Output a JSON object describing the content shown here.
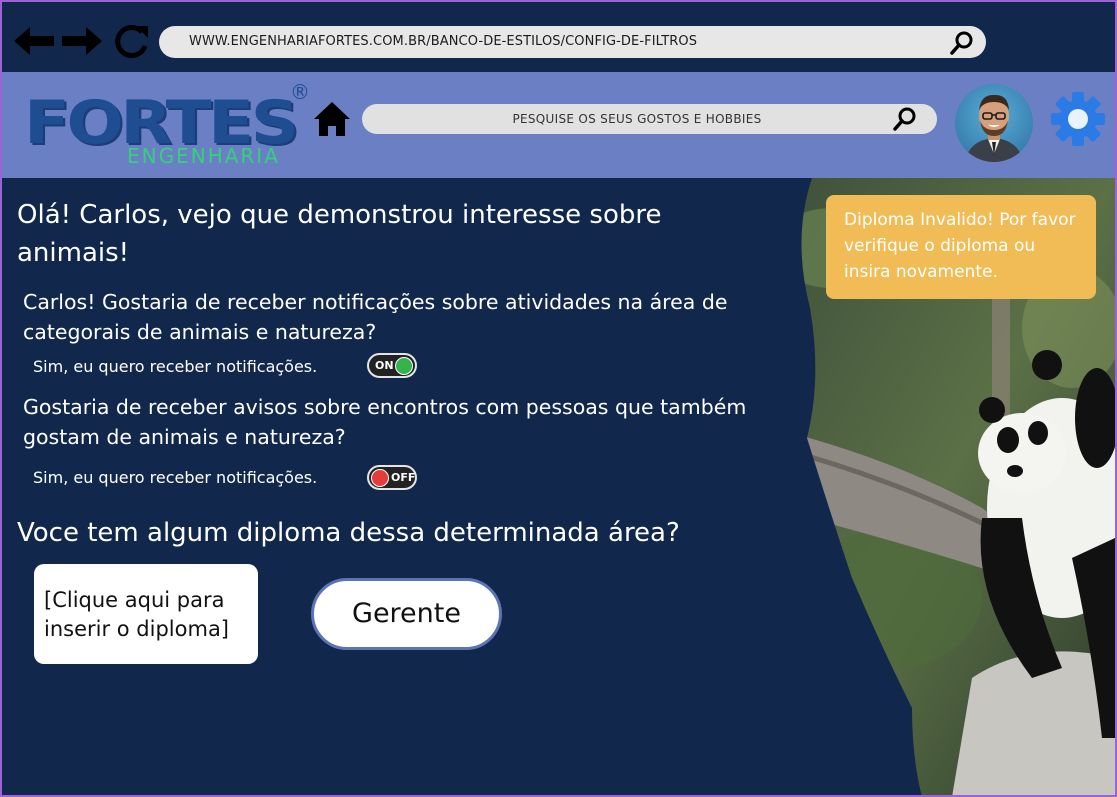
{
  "browser": {
    "url": "WWW.ENGENHARIAFORTES.COM.BR/BANCO-DE-ESTILOS/CONFIG-DE-FILTROS"
  },
  "header": {
    "logo_main": "FORTES",
    "logo_registered": "®",
    "logo_sub": "ENGENHARIA",
    "search_placeholder": "PESQUISE OS SEUS GOSTOS E HOBBIES"
  },
  "main": {
    "greeting": "Olá! Carlos, vejo que demonstrou interesse sobre animais!",
    "question1": "Carlos! Gostaria de receber notificações sobre atividades na área de categorais de animais e natureza?",
    "question1_option": "Sim, eu quero receber notificações.",
    "question1_toggle": "ON",
    "question2": "Gostaria de receber avisos sobre encontros com pessoas que também gostam de animais e natureza?",
    "question2_option": "Sim, eu quero receber notificações.",
    "question2_toggle": "OFF",
    "question3": "Voce tem algum diploma dessa determinada área?",
    "upload_label": "[Clique aqui para inserir o diploma]",
    "manager_button": "Gerente"
  },
  "alert": {
    "text": "Diploma Invalido! Por favor verifique o diploma ou insira novamente."
  },
  "colors": {
    "background": "#11284c",
    "header": "#6b80c4",
    "alert": "#f1bc56",
    "toggle_on": "#34b44a",
    "toggle_off": "#e43b3b",
    "logo": "#1e4d92",
    "logo_sub": "#34d07b"
  },
  "icons": [
    "arrow-left-icon",
    "arrow-right-icon",
    "reload-icon",
    "search-icon",
    "home-icon",
    "gear-icon"
  ]
}
